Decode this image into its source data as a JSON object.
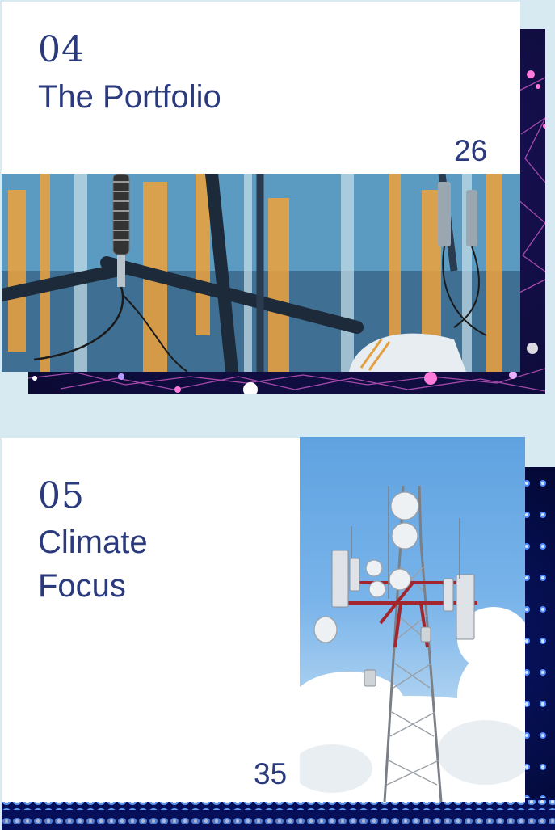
{
  "sections": [
    {
      "number": "04",
      "title": "The Portfolio",
      "page": "26",
      "image": "telecom-antenna-closeup",
      "backdrop": "network-lines-pattern"
    },
    {
      "number": "05",
      "title_lines": [
        "Climate",
        "Focus"
      ],
      "page": "35",
      "image": "cell-tower-sky",
      "backdrop": "led-dot-matrix"
    }
  ],
  "colors": {
    "page_background": "#d7eaf1",
    "heading": "#2a3a7d",
    "card": "#ffffff",
    "network_backdrop": "#140f4a",
    "matrix_backdrop": "#07125f"
  }
}
